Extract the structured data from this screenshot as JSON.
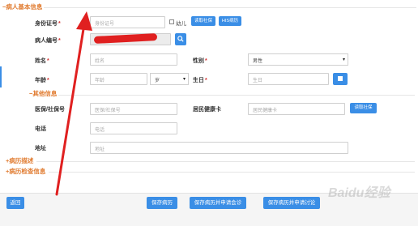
{
  "sections": {
    "basic_info": "−病人基本信息",
    "other_info": "−其他信息",
    "history_desc": "+病历描述",
    "history_exam": "+病历检查信息"
  },
  "fields": {
    "id_card": {
      "label": "身份证号",
      "placeholder": "身份证号"
    },
    "child_checkbox": "幼儿",
    "btn_read_card": "读取社保",
    "btn_his": "HIS病历",
    "patient_no": {
      "label": "病人编号"
    },
    "name": {
      "label": "姓名",
      "placeholder": "姓名"
    },
    "gender": {
      "label": "性别",
      "value": "男性"
    },
    "age": {
      "label": "年龄",
      "placeholder": "年龄",
      "unit": "岁"
    },
    "birthday": {
      "label": "生日",
      "placeholder": "生日"
    },
    "insurance_no": {
      "label": "医保/社保号",
      "placeholder": "医保/社保号"
    },
    "health_card": {
      "label": "居民健康卡",
      "placeholder": "居民健康卡"
    },
    "btn_read_health": "读取社保",
    "phone": {
      "label": "电话",
      "placeholder": "电话"
    },
    "address": {
      "label": "地址",
      "placeholder": "地址"
    }
  },
  "footer": {
    "back": "返回",
    "save": "保存病历",
    "save_apply_consult": "保存病历并申请会诊",
    "save_apply_discuss": "保存病历并申请讨论"
  },
  "watermark": "Baidu经验",
  "colors": {
    "accent": "#3a8ee6",
    "section": "#e07a2e",
    "required": "#d32f2f",
    "annotation": "#e02020"
  }
}
